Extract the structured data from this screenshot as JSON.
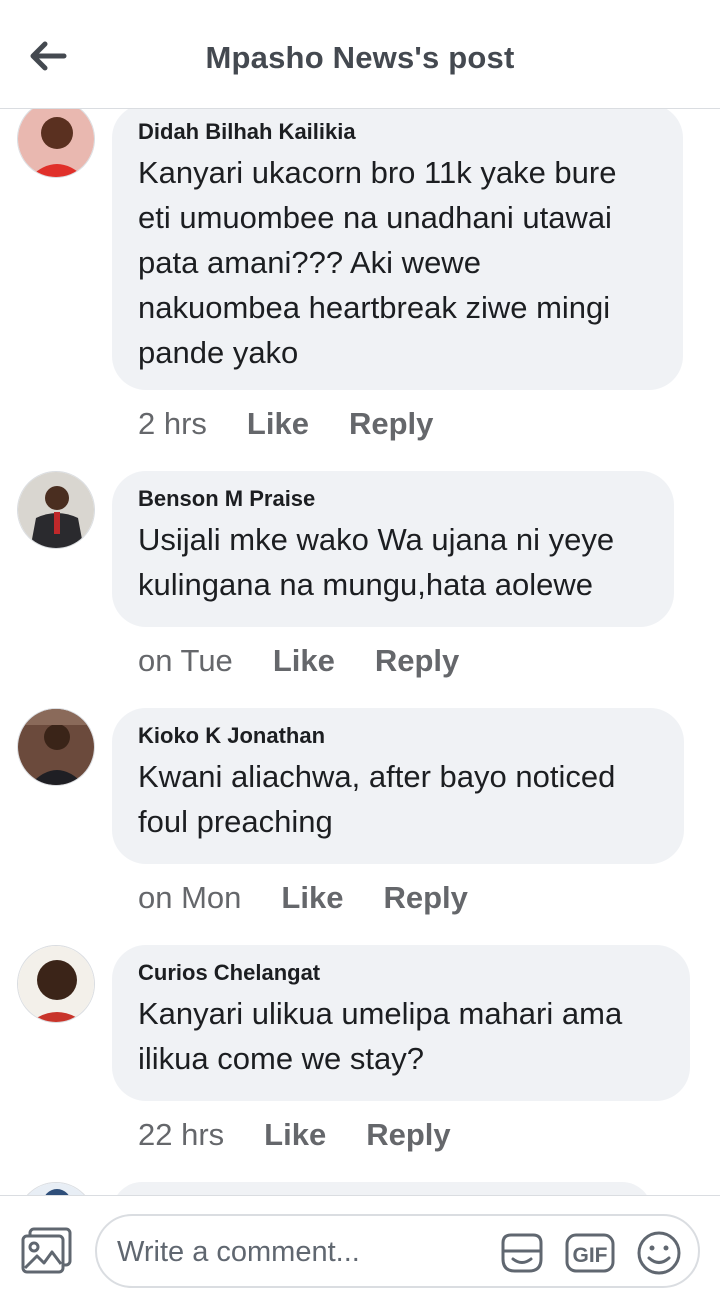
{
  "header": {
    "title": "Mpasho News's post",
    "back_icon": "arrow-left-icon"
  },
  "comments": [
    {
      "author": "Didah Bilhah Kailikia",
      "text_lines": [
        "Kanyari ukacorn bro 11k yake bure",
        "eti umuombee na unadhani utawai",
        "pata amani??? Aki wewe",
        "nakuombea heartbreak ziwe mingi",
        "pande yako"
      ],
      "time": "2 hrs",
      "like": "Like",
      "reply": "Reply"
    },
    {
      "author": "Benson M Praise",
      "text_lines": [
        "Usijali mke wako Wa ujana ni yeye",
        "kulingana na mungu,hata aolewe"
      ],
      "time": "on Tue",
      "like": "Like",
      "reply": "Reply"
    },
    {
      "author": "Kioko K Jonathan",
      "text_lines": [
        "Kwani aliachwa, after bayo noticed",
        "foul preaching"
      ],
      "time": "on Mon",
      "like": "Like",
      "reply": "Reply"
    },
    {
      "author": "Curios Chelangat",
      "text_lines": [
        "Kanyari ulikua umelipa mahari ama",
        "ilikua come we stay?"
      ],
      "time": "22 hrs",
      "like": "Like",
      "reply": "Reply"
    }
  ],
  "composer": {
    "placeholder": "Write a comment...",
    "photo_icon": "photo-icon",
    "sticker_icon": "sticker-icon",
    "gif_label": "GIF",
    "emoji_icon": "emoji-icon"
  },
  "colors": {
    "bubble": "#f0f2f5",
    "meta": "#65676b",
    "title": "#444950"
  }
}
